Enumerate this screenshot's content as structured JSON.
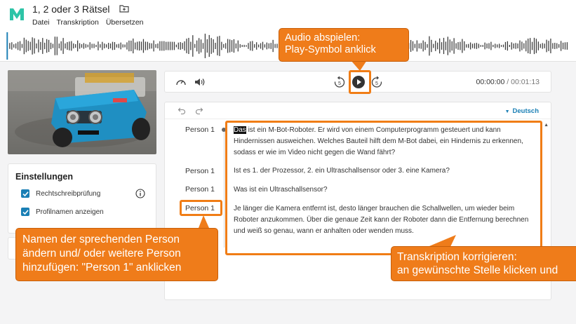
{
  "app": {
    "title": "1, 2 oder 3 Rätsel",
    "menu": [
      "Datei",
      "Transkription",
      "Übersetzen"
    ]
  },
  "player": {
    "current_time": "00:00:00",
    "separator": " / ",
    "duration": "00:01:13",
    "rewind_label": "5",
    "forward_label": "5"
  },
  "settings": {
    "title": "Einstellungen",
    "spellcheck_label": "Rechtschreibprüfung",
    "spellcheck_checked": true,
    "profile_names_label": "Profilnamen anzeigen",
    "profile_names_checked": true
  },
  "editor": {
    "language": "Deutsch",
    "paragraphs": [
      {
        "speaker": "Person 1",
        "highlight": "Das",
        "text": " ist ein M-Bot-Roboter. Er wird von einem Computerprogramm gesteuert und kann Hindernissen ausweichen. Welches Bauteil hilft dem M-Bot dabei, ein Hindernis zu erkennen, sodass er wie im Video nicht gegen die Wand fährt?"
      },
      {
        "speaker": "Person 1",
        "text": "Ist es 1. der Prozessor, 2. ein Ultraschallsensor oder 3. eine Kamera?"
      },
      {
        "speaker": "Person 1",
        "text": "Was ist ein Ultraschallsensor?"
      },
      {
        "speaker": "Person 1",
        "text": "Je länger die Kamera entfernt ist, desto länger brauchen die Schallwellen, um wieder beim Roboter anzukommen. Über die genaue Zeit kann der Roboter dann die Entfernung berechnen und weiß so genau, wann er anhalten oder wenden muss."
      }
    ]
  },
  "annotations": {
    "play": [
      "Audio abspielen:",
      "Play-Symbol anklick"
    ],
    "speaker": [
      "Namen der sprechenden Person",
      "ändern und/ oder weitere Person",
      "hinzufügen: \"Person 1\" anklicken"
    ],
    "transcript": [
      "Transkription korrigieren:",
      "an gewünschte Stelle klicken und"
    ]
  },
  "colors": {
    "accent": "#1a7fb5",
    "annotation": "#ef7c1a",
    "logo": "#2ec4a7"
  },
  "icons": [
    "logo-icon",
    "folder-icon",
    "speedometer-icon",
    "volume-icon",
    "rewind-5-icon",
    "play-icon",
    "forward-5-icon",
    "undo-icon",
    "redo-icon",
    "chevron-down-icon",
    "check-icon",
    "info-icon"
  ]
}
